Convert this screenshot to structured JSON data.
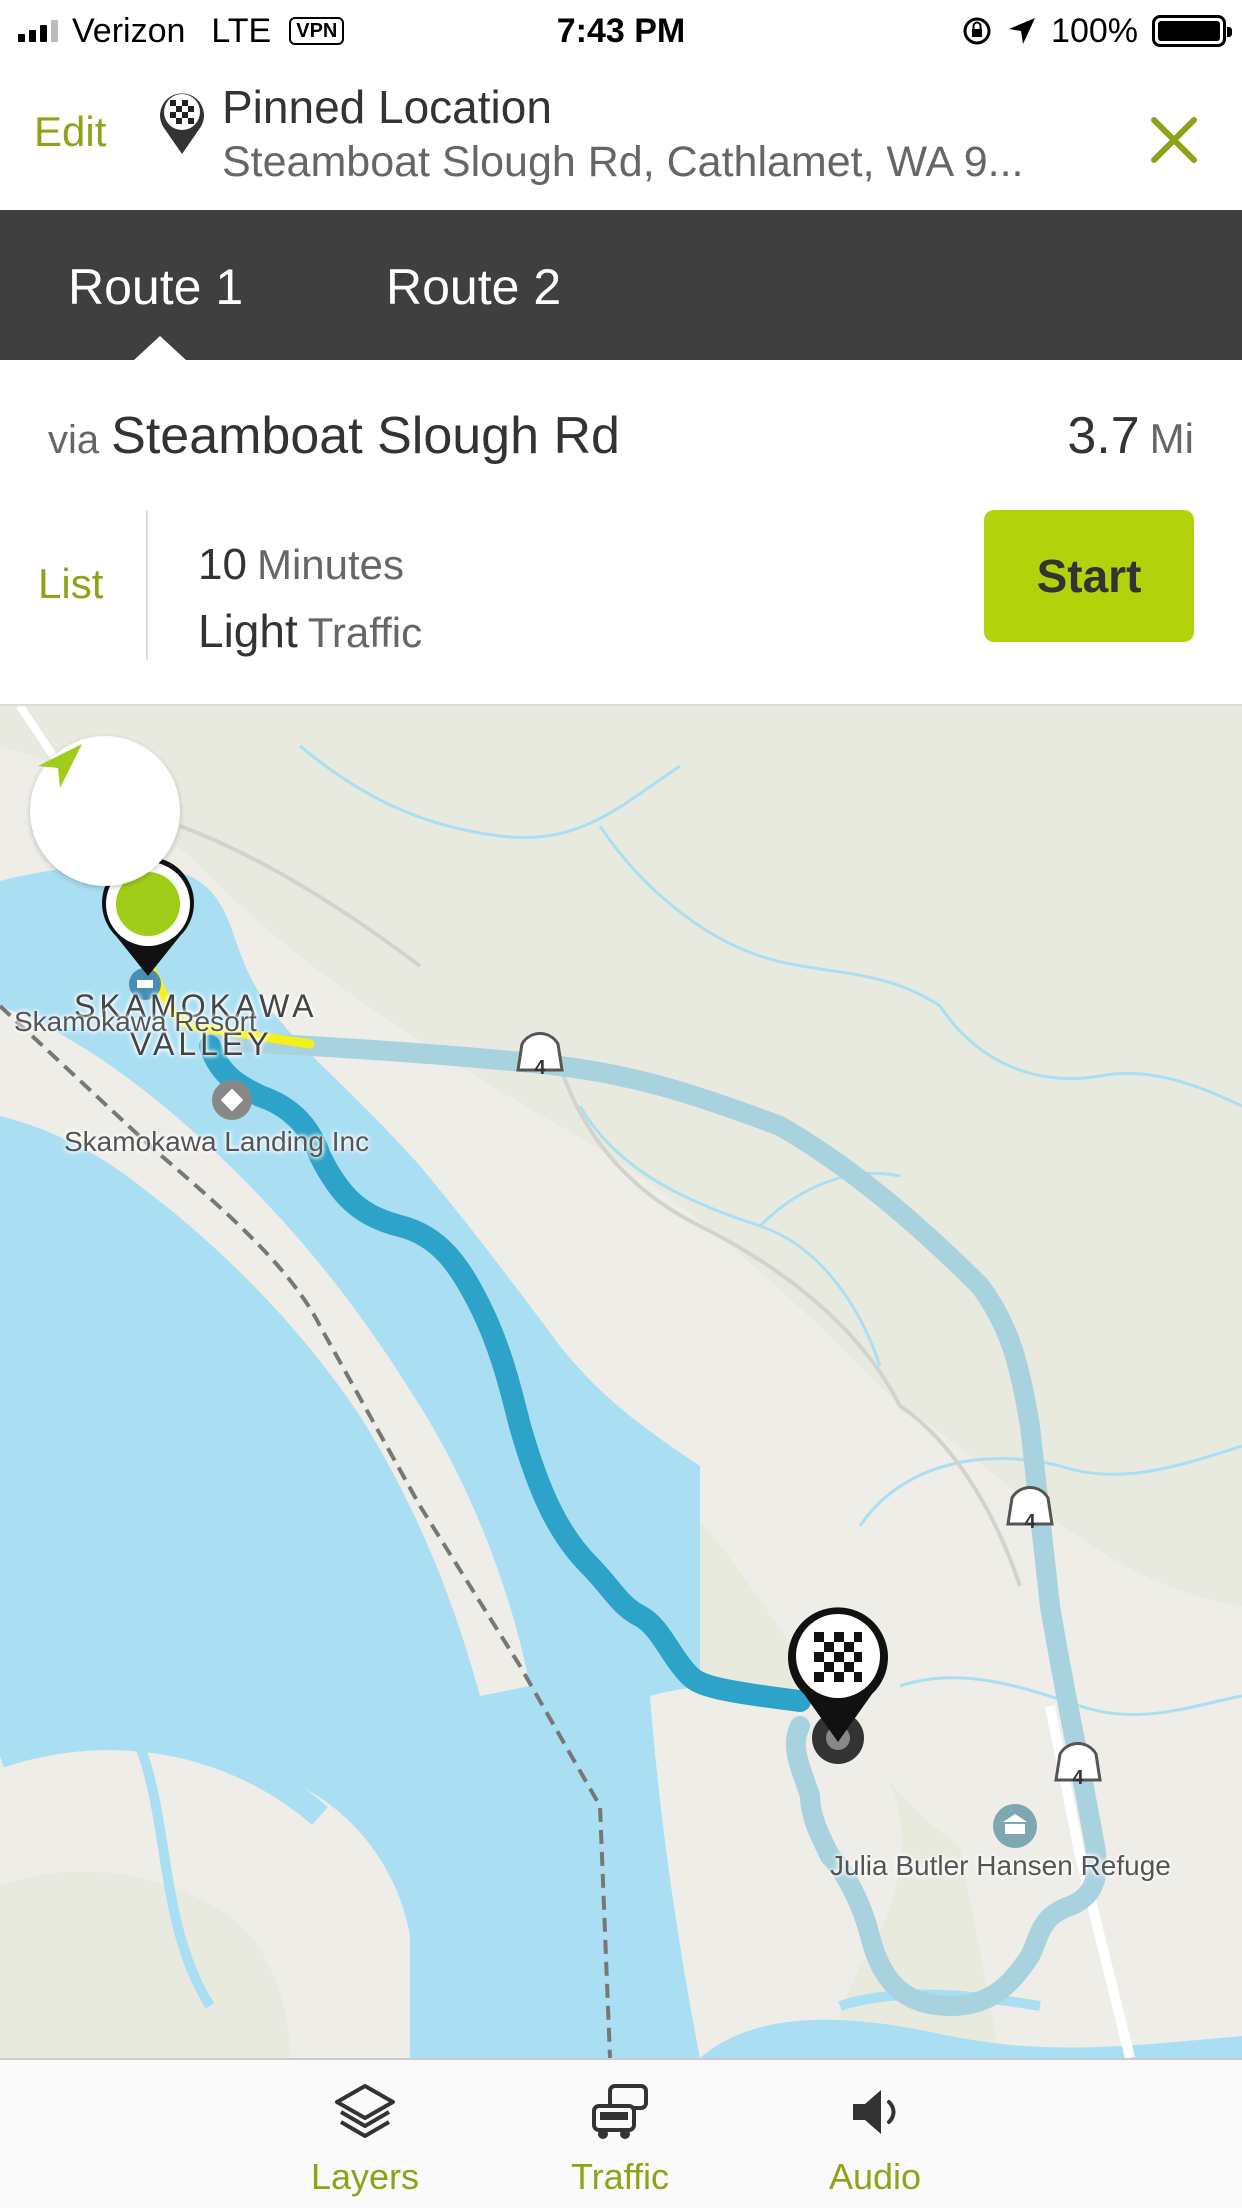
{
  "status_bar": {
    "carrier": "Verizon",
    "network": "LTE",
    "vpn": "VPN",
    "time": "7:43 PM",
    "battery": "100%"
  },
  "header": {
    "edit_label": "Edit",
    "title": "Pinned Location",
    "subtitle": "Steamboat Slough Rd, Cathlamet, WA 9..."
  },
  "tabs": [
    {
      "label": "Route 1",
      "active": true
    },
    {
      "label": "Route 2",
      "active": false
    }
  ],
  "route": {
    "via_prefix": "via",
    "via_road": "Steamboat Slough Rd",
    "distance_value": "3.7",
    "distance_unit": "Mi",
    "list_label": "List",
    "duration_value": "10",
    "duration_unit": "Minutes",
    "traffic_value": "Light",
    "traffic_label": "Traffic",
    "start_label": "Start"
  },
  "map": {
    "labels": {
      "town_line1": "SKAMOKAWA",
      "town_line2": "VALLEY",
      "resort": "Skamokawa Resort",
      "landing": "Skamokawa Landing Inc",
      "refuge": "Julia Butler Hansen Refuge",
      "route_shield": "4"
    },
    "colors": {
      "land": "#eeede7",
      "water": "#aadff3",
      "route_primary": "#2ea3c9",
      "route_alt": "#a9d2df",
      "traffic_light": "#f4f01a",
      "accent": "#b2d20c"
    }
  },
  "bottom_bar": {
    "layers_label": "Layers",
    "traffic_label": "Traffic",
    "audio_label": "Audio"
  }
}
